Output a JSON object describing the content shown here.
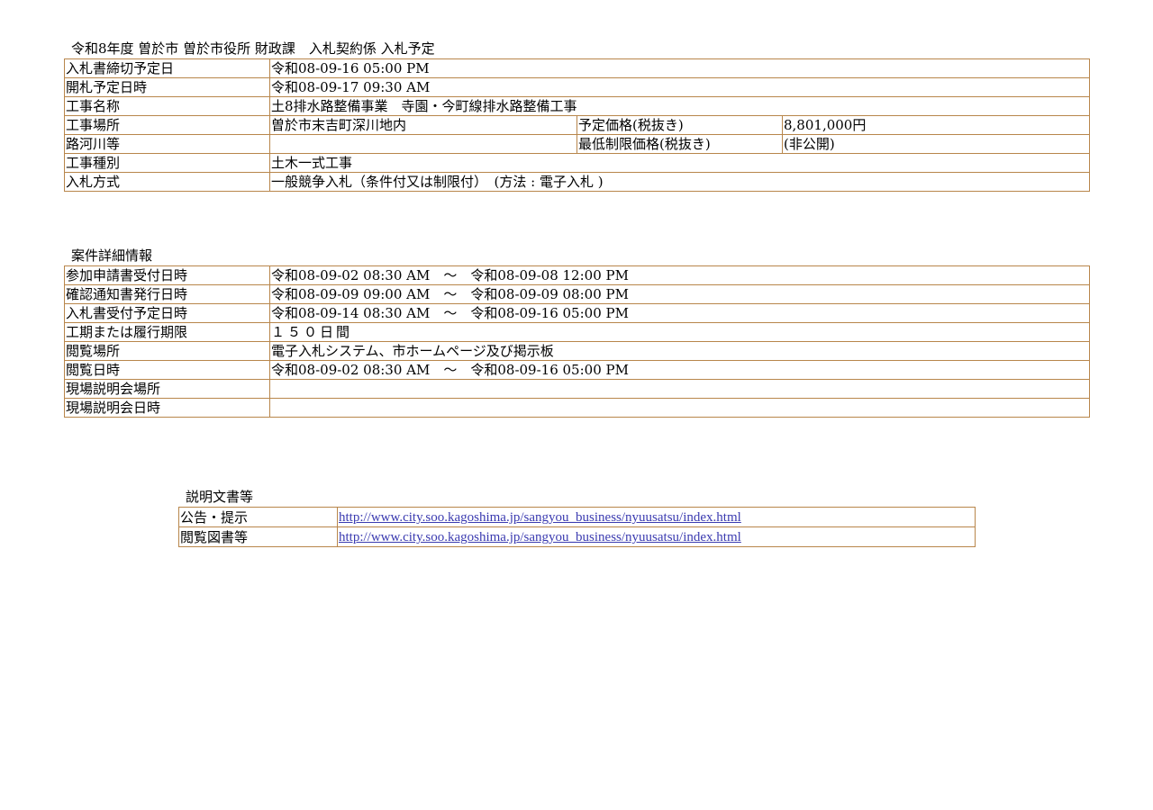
{
  "header": {
    "title": "令和8年度 曽於市 曽於市役所 財政課　入札契約係 入札予定"
  },
  "summary": {
    "bid_deadline": {
      "label": "入札書締切予定日",
      "value": "令和08-09-16 05:00 PM"
    },
    "opening": {
      "label": "開札予定日時",
      "value": "令和08-09-17 09:30 AM"
    },
    "project_name": {
      "label": "工事名称",
      "value": "土8排水路整備事業　寺園・今町線排水路整備工事"
    },
    "location": {
      "label": "工事場所",
      "value": "曽於市末吉町深川地内"
    },
    "planned_price": {
      "label": "予定価格(税抜き)",
      "value": "8,801,000円"
    },
    "road_river": {
      "label": "路河川等",
      "value": ""
    },
    "min_price": {
      "label": "最低制限価格(税抜き)",
      "value": "(非公開)"
    },
    "work_type": {
      "label": "工事種別",
      "value": "土木一式工事"
    },
    "bid_method": {
      "label": "入札方式",
      "value": "一般競争入札（条件付又は制限付）　(方法 : 電子入札 )"
    }
  },
  "detail": {
    "title": "案件詳細情報",
    "rows": [
      {
        "label": "参加申請書受付日時",
        "value": "令和08-09-02 08:30 AM　～　令和08-09-08 12:00 PM"
      },
      {
        "label": "確認通知書発行日時",
        "value": "令和08-09-09 09:00 AM　～　令和08-09-09 08:00 PM"
      },
      {
        "label": "入札書受付予定日時",
        "value": "令和08-09-14 08:30 AM　～　令和08-09-16 05:00 PM"
      },
      {
        "label": "工期または履行期限",
        "value": "１５０日間"
      },
      {
        "label": "閲覧場所",
        "value": "電子入札システム、市ホームページ及び掲示板"
      },
      {
        "label": "閲覧日時",
        "value": "令和08-09-02 08:30 AM　～　令和08-09-16 05:00 PM"
      },
      {
        "label": "現場説明会場所",
        "value": ""
      },
      {
        "label": "現場説明会日時",
        "value": ""
      }
    ]
  },
  "docs": {
    "title": "説明文書等",
    "rows": [
      {
        "label": "公告・提示",
        "link": "http://www.city.soo.kagoshima.jp/sangyou_business/nyuusatsu/index.html"
      },
      {
        "label": "閲覧図書等",
        "link": "http://www.city.soo.kagoshima.jp/sangyou_business/nyuusatsu/index.html"
      }
    ]
  },
  "colors": {
    "border": "#b8864b",
    "link": "#3b3bb0"
  }
}
